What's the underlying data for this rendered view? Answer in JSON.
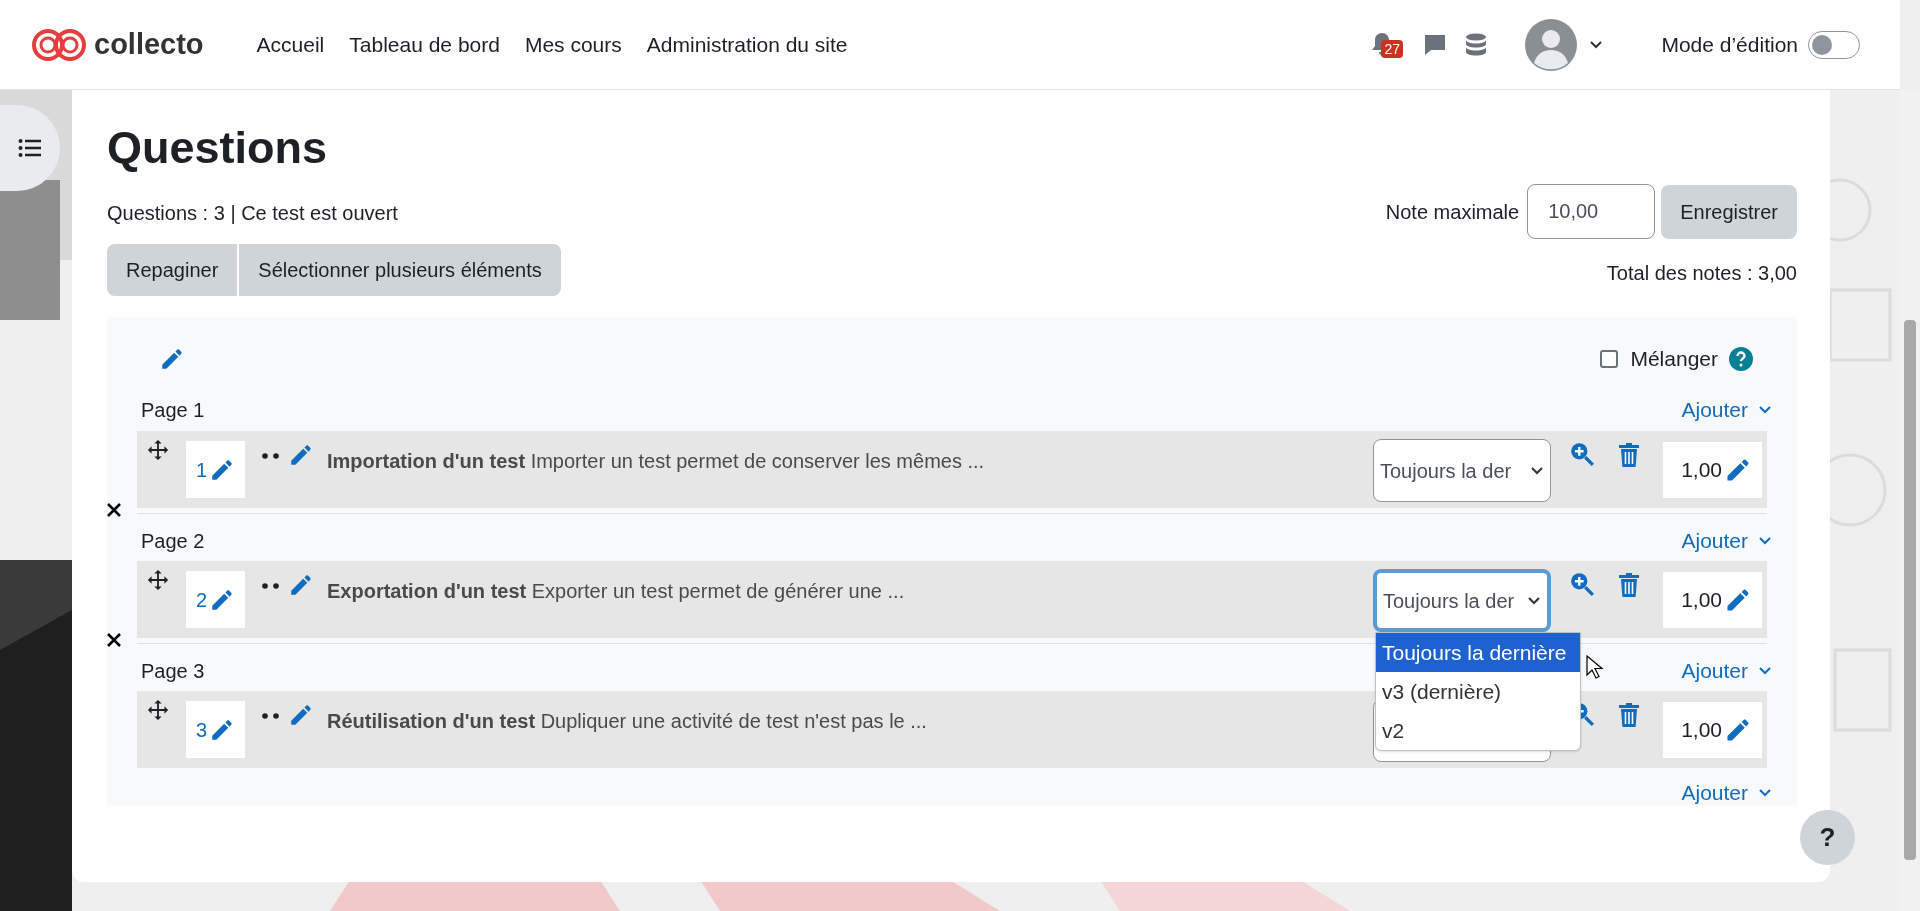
{
  "header": {
    "brand": "collecto",
    "nav": [
      "Accueil",
      "Tableau de bord",
      "Mes cours",
      "Administration du site"
    ],
    "notifications": "27",
    "edit_mode": {
      "label": "Mode d’édition",
      "on": false
    }
  },
  "page": {
    "title": "Questions",
    "summary": "Questions : 3 | Ce test est ouvert",
    "max_grade_label": "Note maximale",
    "max_grade": "10,00",
    "save": "Enregistrer",
    "buttons": [
      "Repaginer",
      "Sélectionner plusieurs éléments"
    ],
    "total": "Total des notes : 3,00"
  },
  "shuffle": {
    "label": "Mélanger",
    "checked": false
  },
  "pages": [
    {
      "label": "Page 1",
      "add": "Ajouter",
      "questions": [
        {
          "number": "1",
          "text": "**Importation d'un test** Importer un test permet de conserver les mêmes ...",
          "version": "Toujours la der",
          "focused": false,
          "mark": "1,00"
        }
      ]
    },
    {
      "label": "Page 2",
      "add": "Ajouter",
      "questions": [
        {
          "number": "2",
          "text": "**Exportation d'un test** Exporter un test permet de générer une ...",
          "version": "Toujours la der",
          "focused": true,
          "mark": "1,00"
        }
      ]
    },
    {
      "label": "Page 3",
      "add": "Ajouter",
      "questions": [
        {
          "number": "3",
          "text": "**Réutilisation d'un test** Dupliquer une activité de test n'est pas le ...",
          "focused": false,
          "mark": "1,00"
        }
      ]
    }
  ],
  "final_add": "Ajouter",
  "version_menu": {
    "options": [
      {
        "label": "Toujours la dernière",
        "selected": true
      },
      {
        "label": "v3 (dernière)",
        "selected": false
      },
      {
        "label": "v2",
        "selected": false
      }
    ]
  },
  "help": "?"
}
